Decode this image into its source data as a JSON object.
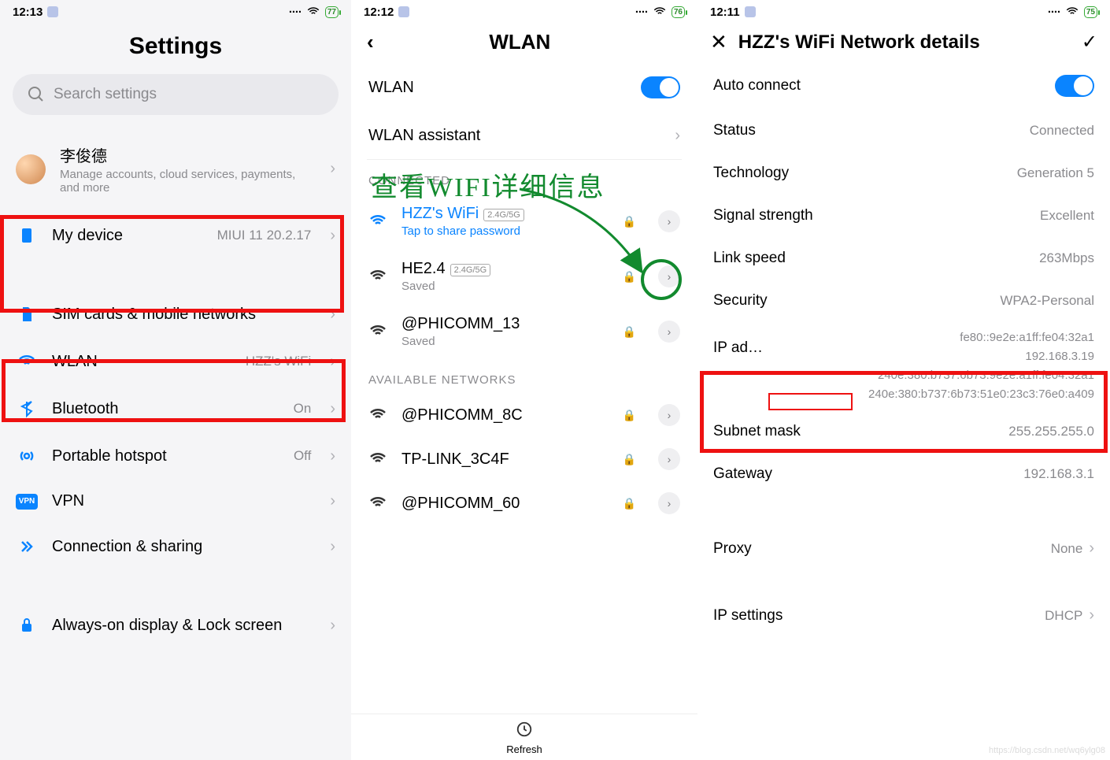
{
  "shot1": {
    "status": {
      "time": "12:13",
      "battery": "77"
    },
    "title": "Settings",
    "search_placeholder": "Search settings",
    "account": {
      "name": "李俊德",
      "sub": "Manage accounts, cloud services, payments, and more"
    },
    "rows": [
      {
        "label": "My device",
        "value": "MIUI 11 20.2.17"
      },
      {
        "label": "SIM cards & mobile networks",
        "value": ""
      },
      {
        "label": "WLAN",
        "value": "HZZ's WiFi"
      },
      {
        "label": "Bluetooth",
        "value": "On"
      },
      {
        "label": "Portable hotspot",
        "value": "Off"
      },
      {
        "label": "VPN",
        "value": ""
      },
      {
        "label": "Connection & sharing",
        "value": ""
      },
      {
        "label": "Always-on display & Lock screen",
        "value": ""
      }
    ]
  },
  "shot2": {
    "status": {
      "time": "12:12",
      "battery": "76"
    },
    "title": "WLAN",
    "wlan_label": "WLAN",
    "assistant_label": "WLAN assistant",
    "section_connected": "CONNECTED",
    "connected": {
      "name": "HZZ's WiFi",
      "badge": "2.4G/5G",
      "sub": "Tap to share password"
    },
    "saved": [
      {
        "name": "HE2.4",
        "badge": "2.4G/5G",
        "sub": "Saved"
      },
      {
        "name": "@PHICOMM_13",
        "sub": "Saved"
      }
    ],
    "section_available": "AVAILABLE NETWORKS",
    "available": [
      {
        "name": "@PHICOMM_8C"
      },
      {
        "name": "TP-LINK_3C4F"
      },
      {
        "name": "@PHICOMM_60"
      }
    ],
    "refresh": "Refresh",
    "annotation": "查看WIFI详细信息"
  },
  "shot3": {
    "status": {
      "time": "12:11",
      "battery": "75"
    },
    "title": "HZZ's WiFi Network details",
    "rows": {
      "auto_connect": "Auto connect",
      "status_l": "Status",
      "status_v": "Connected",
      "tech_l": "Technology",
      "tech_v": "Generation 5",
      "signal_l": "Signal strength",
      "signal_v": "Excellent",
      "speed_l": "Link speed",
      "speed_v": "263Mbps",
      "sec_l": "Security",
      "sec_v": "WPA2-Personal",
      "ip_l": "IP ad…",
      "ip_vals": [
        "fe80::9e2e:a1ff:fe04:32a1",
        "192.168.3.19",
        "240e:380:b737:6b73:9e2e:a1ff:fe04:32a1",
        "240e:380:b737:6b73:51e0:23c3:76e0:a409"
      ],
      "subnet_l": "Subnet mask",
      "subnet_v": "255.255.255.0",
      "gw_l": "Gateway",
      "gw_v": "192.168.3.1",
      "proxy_l": "Proxy",
      "proxy_v": "None",
      "ipset_l": "IP settings",
      "ipset_v": "DHCP"
    }
  },
  "watermark": "https://blog.csdn.net/wq6ylg08"
}
